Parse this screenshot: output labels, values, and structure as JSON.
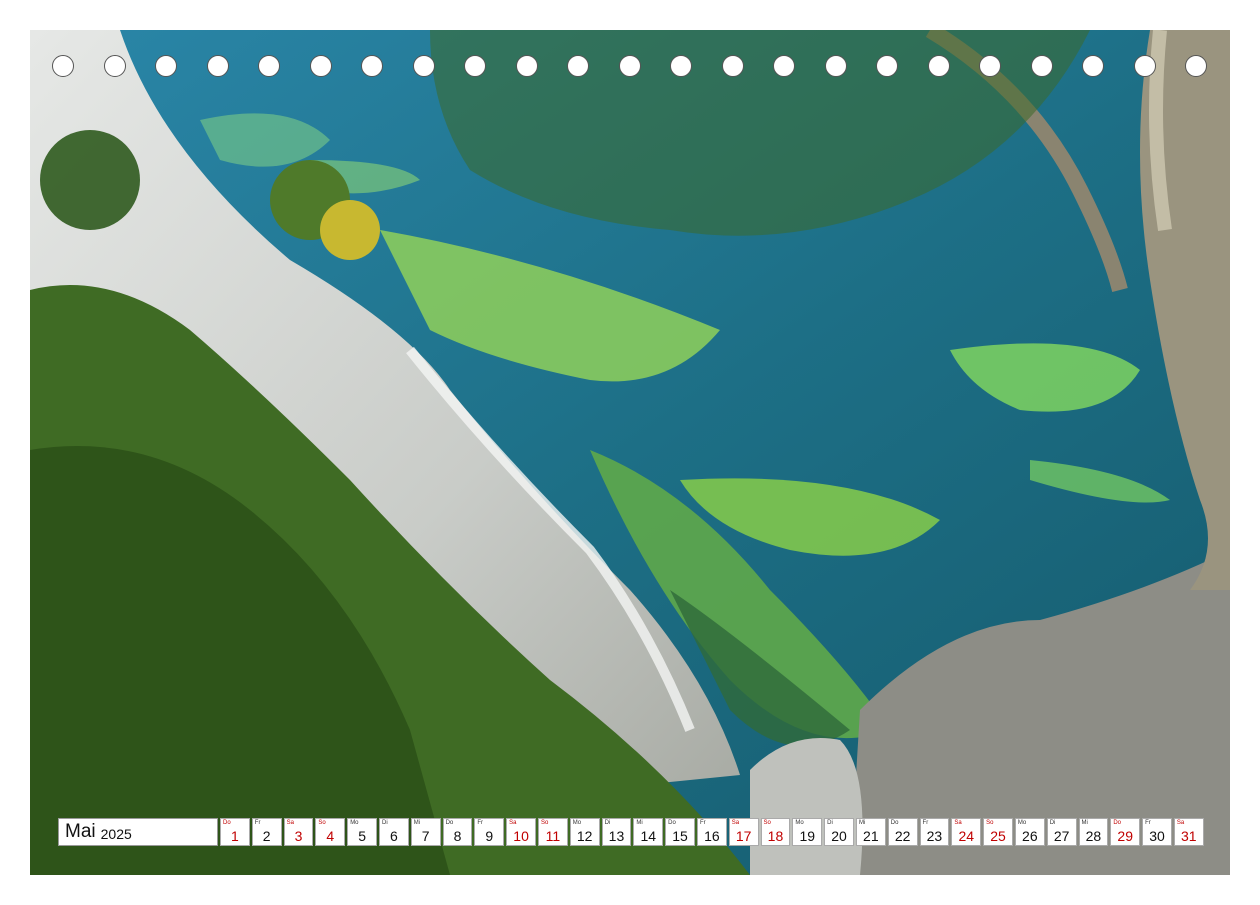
{
  "calendar": {
    "month": "Mai",
    "year": "2025",
    "days": [
      {
        "wd": "Do",
        "n": "1",
        "red": true
      },
      {
        "wd": "Fr",
        "n": "2",
        "red": false
      },
      {
        "wd": "Sa",
        "n": "3",
        "red": true
      },
      {
        "wd": "So",
        "n": "4",
        "red": true
      },
      {
        "wd": "Mo",
        "n": "5",
        "red": false
      },
      {
        "wd": "Di",
        "n": "6",
        "red": false
      },
      {
        "wd": "Mi",
        "n": "7",
        "red": false
      },
      {
        "wd": "Do",
        "n": "8",
        "red": false
      },
      {
        "wd": "Fr",
        "n": "9",
        "red": false
      },
      {
        "wd": "Sa",
        "n": "10",
        "red": true
      },
      {
        "wd": "So",
        "n": "11",
        "red": true
      },
      {
        "wd": "Mo",
        "n": "12",
        "red": false
      },
      {
        "wd": "Di",
        "n": "13",
        "red": false
      },
      {
        "wd": "Mi",
        "n": "14",
        "red": false
      },
      {
        "wd": "Do",
        "n": "15",
        "red": false
      },
      {
        "wd": "Fr",
        "n": "16",
        "red": false
      },
      {
        "wd": "Sa",
        "n": "17",
        "red": true
      },
      {
        "wd": "So",
        "n": "18",
        "red": true
      },
      {
        "wd": "Mo",
        "n": "19",
        "red": false
      },
      {
        "wd": "Di",
        "n": "20",
        "red": false
      },
      {
        "wd": "Mi",
        "n": "21",
        "red": false
      },
      {
        "wd": "Do",
        "n": "22",
        "red": false
      },
      {
        "wd": "Fr",
        "n": "23",
        "red": false
      },
      {
        "wd": "Sa",
        "n": "24",
        "red": true
      },
      {
        "wd": "So",
        "n": "25",
        "red": true
      },
      {
        "wd": "Mo",
        "n": "26",
        "red": false
      },
      {
        "wd": "Di",
        "n": "27",
        "red": false
      },
      {
        "wd": "Mi",
        "n": "28",
        "red": false
      },
      {
        "wd": "Do",
        "n": "29",
        "red": true
      },
      {
        "wd": "Fr",
        "n": "30",
        "red": false
      },
      {
        "wd": "Sa",
        "n": "31",
        "red": true
      }
    ]
  },
  "binding_holes": 23,
  "colors": {
    "holiday_red": "#c00000",
    "water_deep": "#1f6f8c",
    "water_shallow": "#7fc85a",
    "chalk_cliff": "#d9dcda",
    "foliage": "#3f6b24"
  }
}
